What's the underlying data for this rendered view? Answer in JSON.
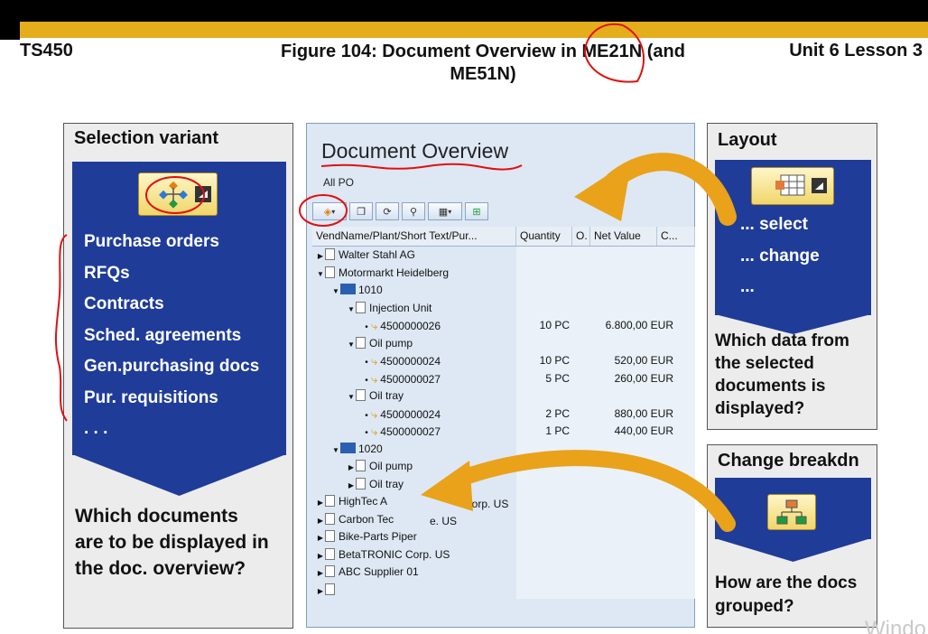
{
  "header": {
    "course_code": "TS450",
    "figure_title_line1": "Figure 104: Document Overview in ME21N (and",
    "figure_title_line2": "ME51N)",
    "unit_lesson": "Unit 6 Lesson 3"
  },
  "left_panel": {
    "title": "Selection variant",
    "items": [
      "Purchase orders",
      "RFQs",
      "Contracts",
      "Sched. agreements",
      "Gen.purchasing docs",
      "Pur. requisitions",
      ". . ."
    ],
    "question": "Which documents are to be displayed in the doc. overview?"
  },
  "center": {
    "title": "Document Overview",
    "variant_label": "All PO",
    "grid_headers": [
      "VendName/Plant/Short Text/Pur...",
      "Quantity",
      "O.",
      "Net Value",
      "C..."
    ],
    "rows": [
      {
        "indent": 0,
        "kind": "vendor",
        "arrow": "▶",
        "text": "Walter Stahl AG",
        "qty": "",
        "value": ""
      },
      {
        "indent": 0,
        "kind": "vendor",
        "arrow": "▼",
        "text": "Motormarkt Heidelberg",
        "qty": "",
        "value": ""
      },
      {
        "indent": 1,
        "kind": "plant",
        "arrow": "▼",
        "text": "1010",
        "qty": "",
        "value": ""
      },
      {
        "indent": 2,
        "kind": "doc",
        "arrow": "▼",
        "text": "Injection Unit",
        "qty": "",
        "value": ""
      },
      {
        "indent": 3,
        "kind": "po",
        "arrow": "•",
        "text": "4500000026",
        "qty": "10 PC",
        "value": "6.800,00 EUR"
      },
      {
        "indent": 2,
        "kind": "doc",
        "arrow": "▼",
        "text": "Oil pump",
        "qty": "",
        "value": ""
      },
      {
        "indent": 3,
        "kind": "po",
        "arrow": "•",
        "text": "4500000024",
        "qty": "10 PC",
        "value": "520,00 EUR"
      },
      {
        "indent": 3,
        "kind": "po",
        "arrow": "•",
        "text": "4500000027",
        "qty": "5 PC",
        "value": "260,00 EUR"
      },
      {
        "indent": 2,
        "kind": "doc",
        "arrow": "▼",
        "text": "Oil tray",
        "qty": "",
        "value": ""
      },
      {
        "indent": 3,
        "kind": "po",
        "arrow": "•",
        "text": "4500000024",
        "qty": "2 PC",
        "value": "880,00 EUR"
      },
      {
        "indent": 3,
        "kind": "po",
        "arrow": "•",
        "text": "4500000027",
        "qty": "1 PC",
        "value": "440,00 EUR"
      },
      {
        "indent": 1,
        "kind": "plant",
        "arrow": "▼",
        "text": "1020",
        "qty": "",
        "value": ""
      },
      {
        "indent": 2,
        "kind": "doc",
        "arrow": "▶",
        "text": "Oil pump",
        "qty": "",
        "value": ""
      },
      {
        "indent": 2,
        "kind": "doc",
        "arrow": "▶",
        "text": "Oil tray",
        "qty": "",
        "value": ""
      },
      {
        "indent": 0,
        "kind": "vendor",
        "arrow": "▶",
        "text": "HighTec A",
        "qty": "",
        "value": ""
      },
      {
        "indent": 0,
        "kind": "vendor",
        "arrow": "▶",
        "text": "Carbon Tec",
        "qty": "",
        "value": ""
      },
      {
        "indent": 0,
        "kind": "vendor",
        "arrow": "▶",
        "text": "Bike-Parts Piper",
        "qty": "",
        "value": ""
      },
      {
        "indent": 0,
        "kind": "vendor",
        "arrow": "▶",
        "text": "BetaTRONIC Corp. US",
        "qty": "",
        "value": ""
      },
      {
        "indent": 0,
        "kind": "vendor",
        "arrow": "▶",
        "text": "ABC Supplier 01",
        "qty": "",
        "value": ""
      },
      {
        "indent": 0,
        "kind": "vendor",
        "arrow": "▶",
        "text": "",
        "qty": "",
        "value": ""
      }
    ],
    "overlay_text_1": "Corp. US",
    "overlay_text_2": "e. US"
  },
  "layout_panel": {
    "title": "Layout",
    "items": [
      "... select",
      "... change",
      "..."
    ],
    "question": "Which data from the selected documents is displayed?"
  },
  "change_panel": {
    "title": "Change breakdn",
    "question": "How are the docs grouped?"
  },
  "watermark": "Windo",
  "colors": {
    "gold": "#e3ad1b",
    "panel_blue": "#1f3c99",
    "arrow_orange": "#e9a21a",
    "annotation_red": "#e01010"
  }
}
